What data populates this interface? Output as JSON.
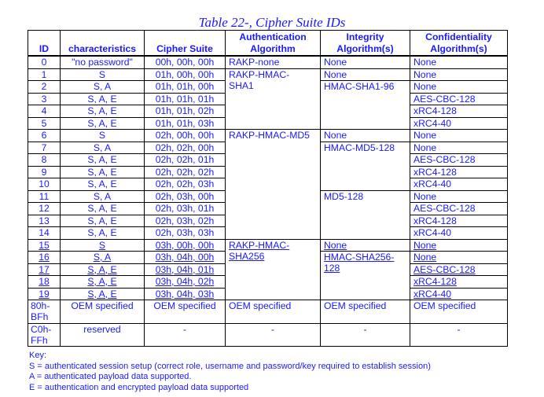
{
  "title": "Table 22-, Cipher Suite IDs",
  "headers": {
    "id": "ID",
    "characteristics": "characteristics",
    "cipher_suite": "Cipher Suite",
    "auth_line1": "Authentication",
    "auth_line2": "Algorithm",
    "integ_line1": "Integrity",
    "integ_line2": "Algorithm(s)",
    "conf_line1": "Confidentiality",
    "conf_line2": "Algorithm(s)"
  },
  "rows": [
    {
      "id": "0",
      "characteristics": "\"no password\"",
      "suite": "00h, 00h, 00h",
      "conf": "None"
    },
    {
      "id": "1",
      "characteristics": "S",
      "suite": "01h, 00h, 00h",
      "conf": "None"
    },
    {
      "id": "2",
      "characteristics": "S, A",
      "suite": "01h, 01h, 00h",
      "conf": "None"
    },
    {
      "id": "3",
      "characteristics": "S, A, E",
      "suite": "01h, 01h, 01h",
      "conf": "AES-CBC-128"
    },
    {
      "id": "4",
      "characteristics": "S, A, E",
      "suite": "01h, 01h, 02h",
      "conf": "xRC4-128"
    },
    {
      "id": "5",
      "characteristics": "S, A, E",
      "suite": "01h, 01h, 03h",
      "conf": "xRC4-40"
    },
    {
      "id": "6",
      "characteristics": "S",
      "suite": "02h, 00h, 00h",
      "conf": "None"
    },
    {
      "id": "7",
      "characteristics": "S, A",
      "suite": "02h, 02h, 00h",
      "conf": "None"
    },
    {
      "id": "8",
      "characteristics": "S, A, E",
      "suite": "02h, 02h, 01h",
      "conf": "AES-CBC-128"
    },
    {
      "id": "9",
      "characteristics": "S, A, E",
      "suite": "02h, 02h, 02h",
      "conf": "xRC4-128"
    },
    {
      "id": "10",
      "characteristics": "S, A, E",
      "suite": "02h, 02h, 03h",
      "conf": "xRC4-40"
    },
    {
      "id": "11",
      "characteristics": "S, A",
      "suite": "02h, 03h, 00h",
      "conf": "None"
    },
    {
      "id": "12",
      "characteristics": "S, A, E",
      "suite": "02h, 03h, 01h",
      "conf": "AES-CBC-128"
    },
    {
      "id": "13",
      "characteristics": "S, A, E",
      "suite": "02h, 03h, 02h",
      "conf": "xRC4-128"
    },
    {
      "id": "14",
      "characteristics": "S, A, E",
      "suite": "02h, 03h, 03h",
      "conf": "xRC4-40"
    },
    {
      "id": "15",
      "characteristics": "S",
      "suite": "03h, 00h, 00h",
      "conf": "None"
    },
    {
      "id": "16",
      "characteristics": "S, A",
      "suite": "03h, 04h, 00h",
      "conf": "None"
    },
    {
      "id": "17",
      "characteristics": "S, A, E",
      "suite": "03h, 04h, 01h",
      "conf": "AES-CBC-128"
    },
    {
      "id": "18",
      "characteristics": "S, A, E",
      "suite": "03h, 04h, 02h",
      "conf": "xRC4-128"
    },
    {
      "id": "19",
      "characteristics": "S, A, E",
      "suite": "03h, 04h, 03h",
      "conf": "xRC4-40"
    }
  ],
  "auth_groups": [
    {
      "label": "RAKP-none"
    },
    {
      "label": "RAKP-HMAC-SHA1"
    },
    {
      "label": "RAKP-HMAC-MD5"
    },
    {
      "label": "RAKP-HMAC-SHA256"
    }
  ],
  "integ_groups": [
    {
      "label": "None"
    },
    {
      "label": "None"
    },
    {
      "label": "HMAC-SHA1-96"
    },
    {
      "label": "None"
    },
    {
      "label": "HMAC-MD5-128"
    },
    {
      "label": "MD5-128"
    },
    {
      "label": "None"
    },
    {
      "label": "HMAC-SHA256-128"
    }
  ],
  "oem_row": {
    "id": "80h-BFh",
    "characteristics": "OEM specified",
    "suite": "OEM specified",
    "auth": "OEM specified",
    "integ": "OEM specified",
    "conf": "OEM specified"
  },
  "reserved_row": {
    "id": "C0h-FFh",
    "characteristics": "reserved",
    "suite": "-",
    "auth": "-",
    "integ": "-",
    "conf": "-"
  },
  "key": {
    "heading": "Key:",
    "lines": [
      "S = authenticated session setup (correct role, username and password/key required to establish session)",
      "A = authenticated payload data supported.",
      "E = authentication and encrypted payload data supported"
    ]
  },
  "colors": {
    "text": "#1a1aff",
    "border": "#000000"
  }
}
